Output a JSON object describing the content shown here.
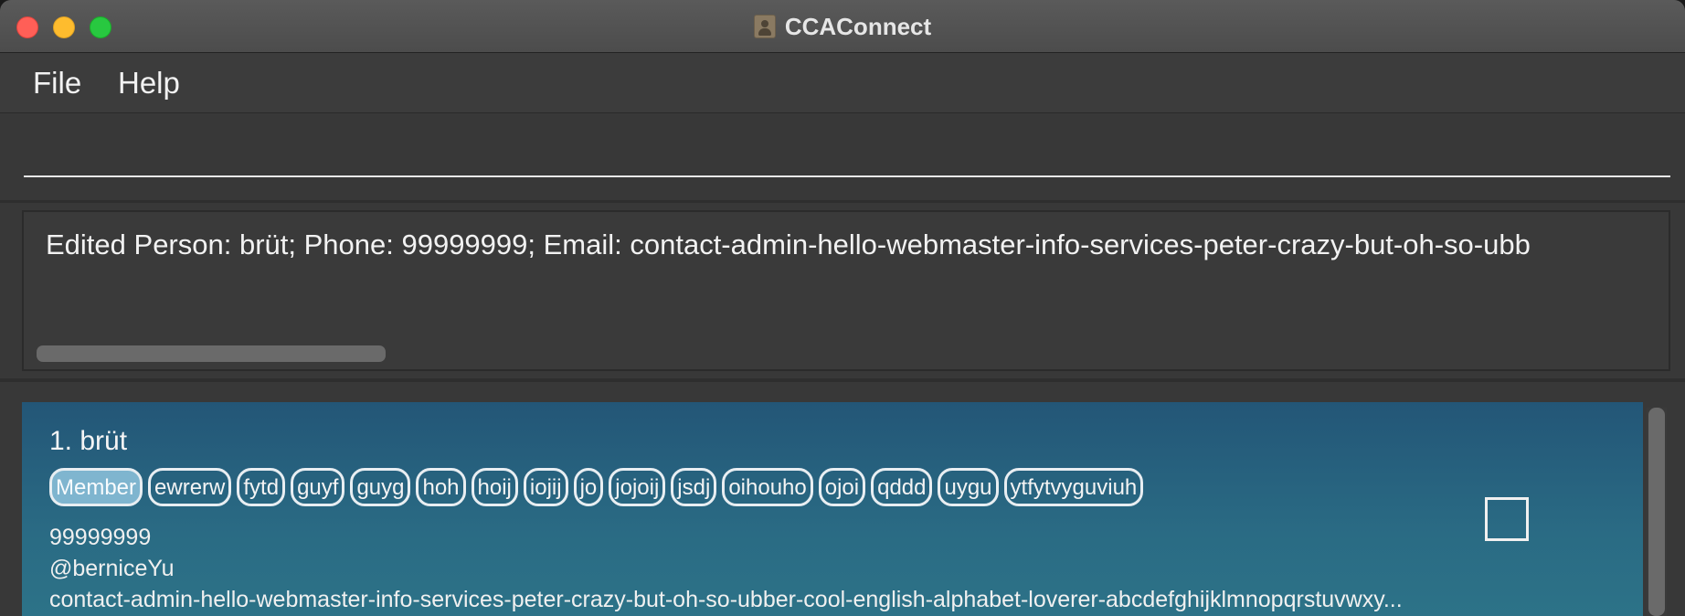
{
  "window": {
    "title": "CCAConnect"
  },
  "menu": {
    "items": [
      "File",
      "Help"
    ]
  },
  "command": {
    "value": "",
    "placeholder": ""
  },
  "result": {
    "text": "Edited Person: brüt; Phone: 99999999; Email: contact-admin-hello-webmaster-info-services-peter-crazy-but-oh-so-ubb"
  },
  "person": {
    "index_name": "1. brüt",
    "tags": [
      "Member",
      "ewrerw",
      "fytd",
      "guyf",
      "guyg",
      "hoh",
      "hoij",
      "iojij",
      "jo",
      "jojoij",
      "jsdj",
      "oihouho",
      "ojoi",
      "qddd",
      "uygu",
      "ytfytvyguviuh"
    ],
    "phone": "99999999",
    "handle": "@berniceYu",
    "email": "contact-admin-hello-webmaster-info-services-peter-crazy-but-oh-so-ubber-cool-english-alphabet-loverer-abcdefghijklmnopqrstuvwxy..."
  },
  "colors": {
    "card_gradient_top": "#235677",
    "card_gradient_bottom": "#2d7388",
    "primary_tag_bg": "#7fb5cf",
    "background": "#383838"
  }
}
